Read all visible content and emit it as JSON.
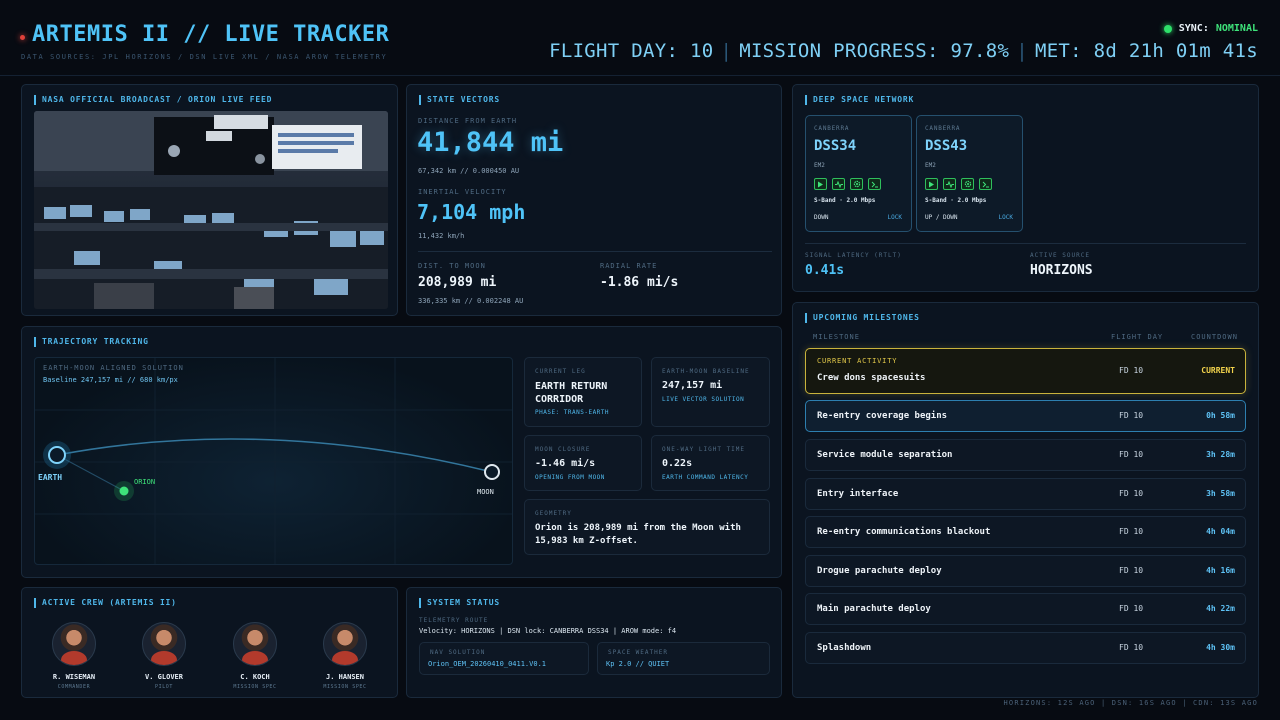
{
  "header": {
    "title": "ARTEMIS II // LIVE TRACKER",
    "subtitle": "DATA SOURCES: JPL HORIZONS / DSN LIVE XML / NASA AROW TELEMETRY",
    "sync_label": "SYNC:",
    "sync_value": "NOMINAL",
    "flight_day": "FLIGHT DAY: 10",
    "mission_progress": "MISSION PROGRESS: 97.8%",
    "met": "MET: 8d 21h 01m 41s",
    "separator": "|"
  },
  "broadcast": {
    "title": "NASA OFFICIAL BROADCAST / ORION LIVE FEED"
  },
  "state_vectors": {
    "title": "STATE VECTORS",
    "distance_label": "DISTANCE FROM EARTH",
    "distance_value": "41,844 mi",
    "distance_sub": "67,342 km // 0.000450 AU",
    "velocity_label": "INERTIAL VELOCITY",
    "velocity_value": "7,104 mph",
    "velocity_sub": "11,432 km/h",
    "moon_label": "DIST. TO MOON",
    "moon_value": "208,989 mi",
    "moon_sub": "336,335 km // 0.002248 AU",
    "radial_label": "RADIAL RATE",
    "radial_value": "-1.86 mi/s"
  },
  "dsn": {
    "title": "DEEP SPACE NETWORK",
    "dishes": [
      {
        "site": "CANBERRA",
        "name": "DSS34",
        "target": "EM2",
        "band": "S-Band · 2.0 Mbps",
        "direction": "DOWN",
        "status": "LOCK"
      },
      {
        "site": "CANBERRA",
        "name": "DSS43",
        "target": "EM2",
        "band": "S-Band · 2.0 Mbps",
        "direction": "UP / DOWN",
        "status": "LOCK"
      }
    ],
    "latency_label": "SIGNAL LATENCY (RTLT)",
    "latency_value": "0.41s",
    "source_label": "ACTIVE SOURCE",
    "source_value": "HORIZONS"
  },
  "trajectory": {
    "title": "TRAJECTORY TRACKING",
    "solution_label": "EARTH-MOON ALIGNED SOLUTION",
    "baseline_text": "Baseline 247,157 mi // 680 km/px",
    "earth_label": "EARTH",
    "orion_label": "ORION",
    "moon_label": "MOON",
    "cards": {
      "leg_label": "CURRENT LEG",
      "leg_value": "EARTH RETURN CORRIDOR",
      "leg_sub": "PHASE: TRANS-EARTH",
      "baseline_label": "EARTH-MOON BASELINE",
      "baseline_value": "247,157 mi",
      "baseline_sub": "LIVE VECTOR SOLUTION",
      "closure_label": "MOON CLOSURE",
      "closure_value": "-1.46 mi/s",
      "closure_sub": "OPENING FROM MOON",
      "light_label": "ONE-WAY LIGHT TIME",
      "light_value": "0.22s",
      "light_sub": "EARTH COMMAND LATENCY",
      "geometry_label": "GEOMETRY",
      "geometry_text": "Orion is 208,989 mi from the Moon with 15,983 km Z-offset."
    }
  },
  "milestones": {
    "title": "UPCOMING MILESTONES",
    "col_milestone": "MILESTONE",
    "col_day": "FLIGHT DAY",
    "col_countdown": "COUNTDOWN",
    "current_tag": "CURRENT ACTIVITY",
    "items": [
      {
        "name": "Crew dons spacesuits",
        "day": "FD 10",
        "countdown": "CURRENT"
      },
      {
        "name": "Re-entry coverage begins",
        "day": "FD 10",
        "countdown": "0h 58m"
      },
      {
        "name": "Service module separation",
        "day": "FD 10",
        "countdown": "3h 28m"
      },
      {
        "name": "Entry interface",
        "day": "FD 10",
        "countdown": "3h 58m"
      },
      {
        "name": "Re-entry communications blackout",
        "day": "FD 10",
        "countdown": "4h 04m"
      },
      {
        "name": "Drogue parachute deploy",
        "day": "FD 10",
        "countdown": "4h 16m"
      },
      {
        "name": "Main parachute deploy",
        "day": "FD 10",
        "countdown": "4h 22m"
      },
      {
        "name": "Splashdown",
        "day": "FD 10",
        "countdown": "4h 30m"
      }
    ]
  },
  "crew": {
    "title": "ACTIVE CREW (ARTEMIS II)",
    "members": [
      {
        "name": "R. WISEMAN",
        "role": "COMMANDER"
      },
      {
        "name": "V. GLOVER",
        "role": "PILOT"
      },
      {
        "name": "C. KOCH",
        "role": "MISSION SPEC"
      },
      {
        "name": "J. HANSEN",
        "role": "MISSION SPEC"
      }
    ]
  },
  "system": {
    "title": "SYSTEM STATUS",
    "route_label": "TELEMETRY ROUTE",
    "route_value": "Velocity: HORIZONS | DSN lock: CANBERRA DSS34 | AROW mode: f4",
    "nav_label": "NAV SOLUTION",
    "nav_value": "Orion_OEM_20260410_0411.V0.1",
    "weather_label": "SPACE WEATHER",
    "weather_value": "Kp 2.0 // QUIET"
  },
  "footer": {
    "text": "HORIZONS: 12S AGO | DSN: 16S AGO | CDN: 13S AGO"
  },
  "colors": {
    "accent": "#4fc3f7",
    "ok": "#2ee06a",
    "current": "#e2c94a",
    "background": "#070b12"
  }
}
